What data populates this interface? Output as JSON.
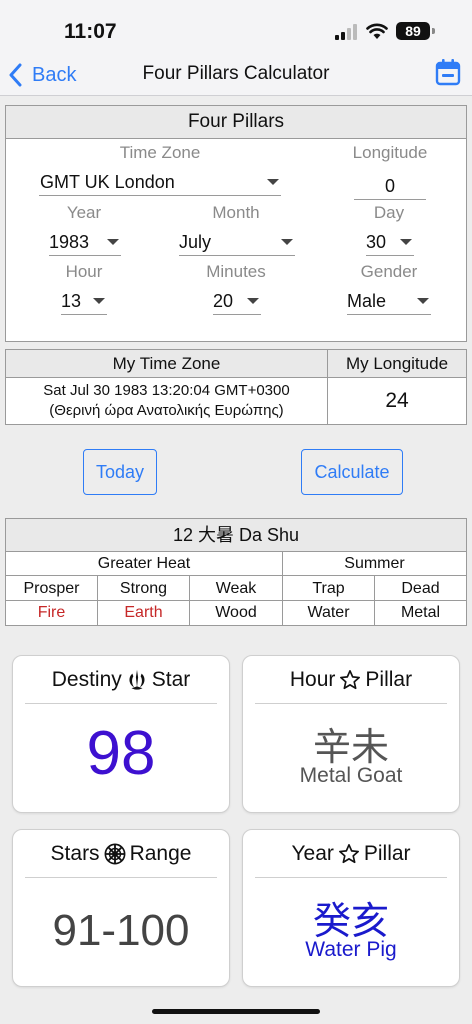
{
  "status": {
    "time": "11:07",
    "battery": "89"
  },
  "nav": {
    "back_label": "Back",
    "title": "Four Pillars Calculator"
  },
  "pillars": {
    "title": "Four Pillars",
    "timezone": {
      "label": "Time Zone",
      "value": "GMT UK London"
    },
    "longitude": {
      "label": "Longitude",
      "value": "0"
    },
    "year": {
      "label": "Year",
      "value": "1983"
    },
    "month": {
      "label": "Month",
      "value": "July"
    },
    "day": {
      "label": "Day",
      "value": "30"
    },
    "hour": {
      "label": "Hour",
      "value": "13"
    },
    "minutes": {
      "label": "Minutes",
      "value": "20"
    },
    "gender": {
      "label": "Gender",
      "value": "Male"
    }
  },
  "my_tz": {
    "col1": "My Time Zone",
    "col2": "My Longitude",
    "datetime": "Sat Jul 30 1983 13:20:04 GMT+0300",
    "zone_name": "(Θερινή ώρα Ανατολικής Ευρώπης)",
    "longitude": "24"
  },
  "buttons": {
    "today": "Today",
    "calculate": "Calculate"
  },
  "term": {
    "title": "12 大暑 Da Shu",
    "group1": "Greater Heat",
    "group2": "Summer",
    "headers": [
      "Prosper",
      "Strong",
      "Weak",
      "Trap",
      "Dead"
    ],
    "values": [
      "Fire",
      "Earth",
      "Wood",
      "Water",
      "Metal"
    ]
  },
  "cards": {
    "destiny": {
      "left": "Destiny",
      "right": "Star",
      "value": "98",
      "color": "#3d10d0"
    },
    "hour": {
      "left": "Hour",
      "right": "Pillar",
      "chinese": "辛未",
      "english": "Metal Goat",
      "color": "#555555"
    },
    "stars": {
      "left": "Stars",
      "right": "Range",
      "value": "91-100",
      "color": "#444444"
    },
    "year": {
      "left": "Year",
      "right": "Pillar",
      "chinese": "癸亥",
      "english": "Water Pig",
      "color": "#1a1acc"
    }
  },
  "colors": {
    "accent": "#2f7cf6",
    "warn": "#c62828"
  }
}
